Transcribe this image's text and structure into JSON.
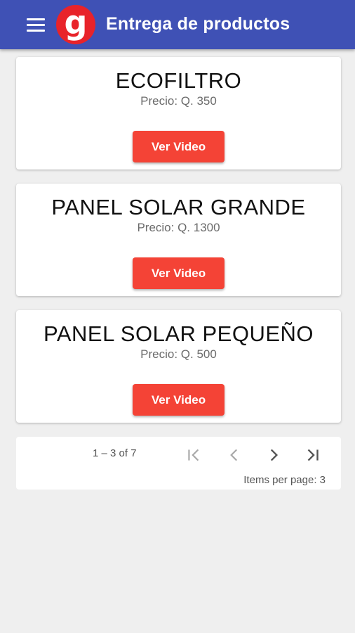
{
  "appbar": {
    "title": "Entrega de productos",
    "logo_letter": "g",
    "icons": {
      "menu": "menu-icon"
    }
  },
  "products": [
    {
      "name": "ECOFILTRO",
      "price": "Precio: Q. 350",
      "button_label": "Ver Video"
    },
    {
      "name": "PANEL SOLAR GRANDE",
      "price": "Precio: Q. 1300",
      "button_label": "Ver Video"
    },
    {
      "name": "PANEL SOLAR PEQUEÑO",
      "price": "Precio: Q. 500",
      "button_label": "Ver Video"
    }
  ],
  "paginator": {
    "range_label": "1 – 3 of 7",
    "items_per_page_label": "Items per page: 3",
    "icons": [
      "first-page-icon",
      "previous-page-icon",
      "next-page-icon",
      "last-page-icon"
    ]
  },
  "colors": {
    "appbar": "#3f51b5",
    "logo": "#e8232a",
    "button": "#f44336",
    "background": "#efefef"
  }
}
